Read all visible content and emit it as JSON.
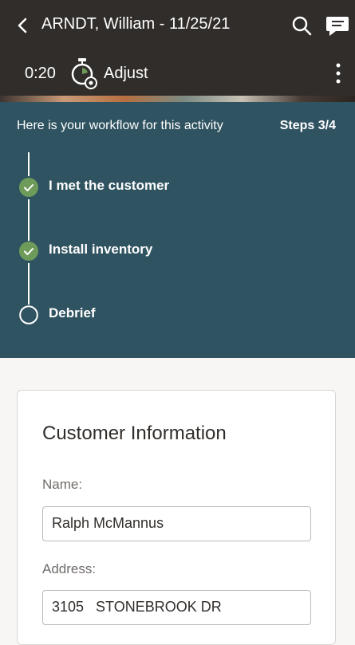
{
  "header": {
    "title": "ARNDT, William - 11/25/21",
    "back_icon": "chevron-left-icon",
    "search_icon": "search-icon",
    "chat_icon": "chat-icon"
  },
  "subbar": {
    "timer": "0:20",
    "timer_icon": "stopwatch-gear-icon",
    "adjust_label": "Adjust",
    "more_icon": "more-vertical-icon"
  },
  "workflow": {
    "intro": "Here is your workflow for this activity",
    "steps_counter": "Steps 3/4",
    "steps": [
      {
        "label": "I met the customer",
        "status": "completed"
      },
      {
        "label": "Install inventory",
        "status": "completed"
      },
      {
        "label": "Debrief",
        "status": "pending"
      }
    ]
  },
  "customer_info": {
    "title": "Customer Information",
    "name_label": "Name:",
    "name_value": "Ralph McMannus",
    "address_label": "Address:",
    "address_value": "3105   STONEBROOK DR"
  },
  "colors": {
    "header_bg": "#312d2a",
    "workflow_bg": "#2f5361",
    "check_green": "#6f9b5a"
  }
}
